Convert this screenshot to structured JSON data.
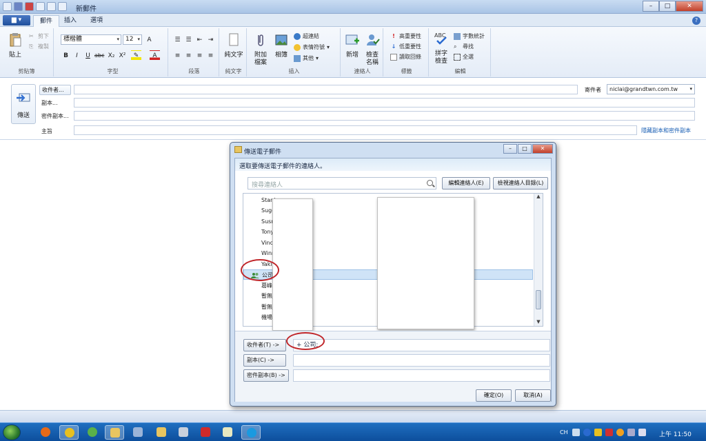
{
  "window": {
    "title": "新郵件",
    "controls": {
      "minimize": "–",
      "maximize": "□",
      "close": "✕"
    }
  },
  "ribbon_tabs": {
    "file": "▆ ▾",
    "tabs": [
      "郵件",
      "插入",
      "選項"
    ],
    "help": "?"
  },
  "ribbon": {
    "clipboard": {
      "paste": "貼上",
      "cut": "剪下",
      "copy": "複製",
      "label": "剪貼簿"
    },
    "font": {
      "family": "標楷體",
      "size": "12",
      "label": "字型",
      "bold": "B",
      "italic": "I",
      "underline": "U",
      "strike": "abc",
      "sub": "X₂",
      "sup": "X²",
      "fontcolor": "A"
    },
    "paragraph": {
      "label": "段落"
    },
    "plaintext": {
      "button": "純文字",
      "label": "純文字"
    },
    "insert": {
      "attach": "附加\n檔案",
      "photo": "相簿",
      "hyperlink": "超連結",
      "emoticon": "表情符號",
      "other": "其他",
      "label": "插入"
    },
    "contacts": {
      "new": "新增",
      "check": "檢查\n名稱",
      "label": "連絡人"
    },
    "tags": {
      "high": "高重要性",
      "low": "低重要性",
      "read_receipt": "讀取回條",
      "label": "標籤"
    },
    "editing": {
      "spell": "拼字\n檢查",
      "wordcount": "字數統計",
      "find": "尋找",
      "selectall": "全選",
      "label": "編輯"
    }
  },
  "header": {
    "send": "傳送",
    "to_button": "收件者...",
    "cc_label": "副本...",
    "bcc_label": "密件副本...",
    "subject_label": "主旨",
    "sender_label": "寄件者",
    "sender_value": "niclai@grandtwn.com.tw",
    "bcc_link": "隱藏副本和密件副本"
  },
  "dialog": {
    "title": "傳送電子郵件",
    "instruction": "選取要傳送電子郵件的連絡人。",
    "search_placeholder": "搜尋連絡人",
    "edit_contact": "編輯連絡人(E)",
    "view_directory": "檢視連絡人目錄(L)",
    "contacts": [
      "Stanl",
      "Suge",
      "Susn",
      "Tony",
      "Vince",
      "Winn",
      "Yaki",
      "公司",
      "葛峰",
      "暫無",
      "暫無",
      "機場"
    ],
    "selected_index": 7,
    "to_button": "收件者(T) ->",
    "cc_button": "副本(C) ->",
    "bcc_button": "密件副本(B) ->",
    "to_value": "+ 公司;",
    "ok": "確定(O)",
    "cancel": "取消(A)"
  },
  "taskbar": {
    "lang": "CH",
    "clock": "上午 11:50"
  }
}
